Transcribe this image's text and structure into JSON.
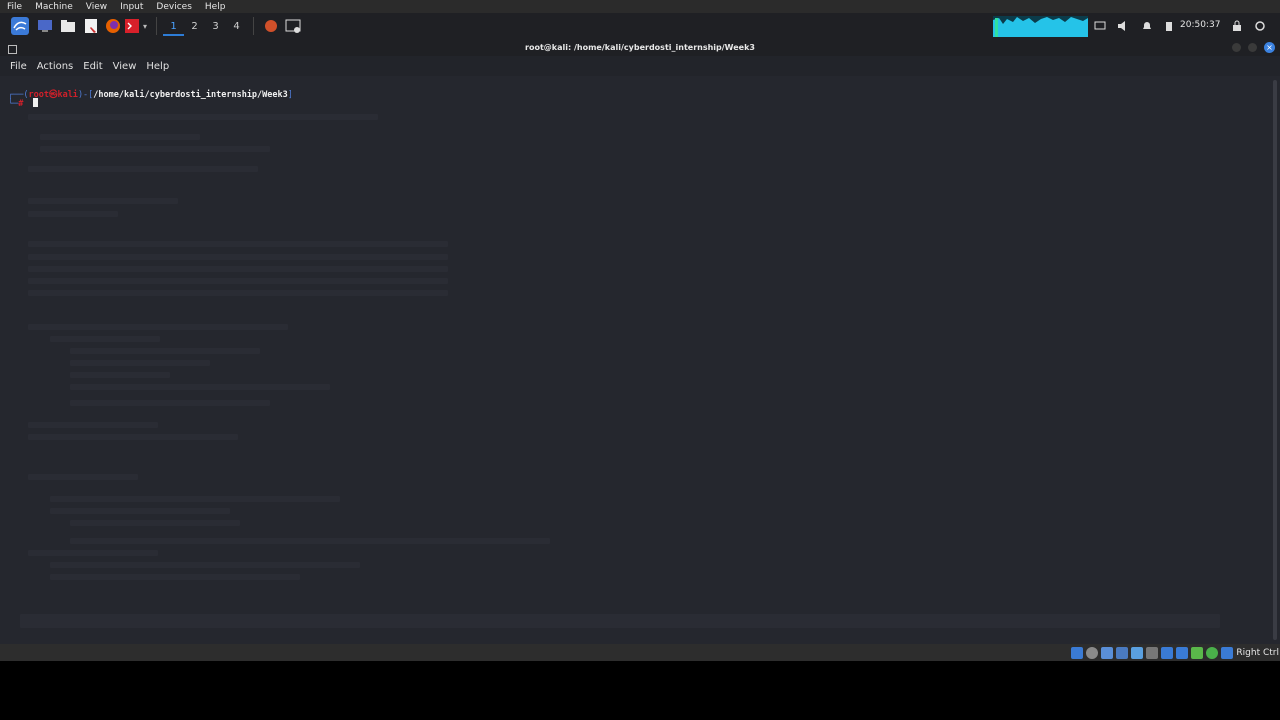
{
  "vbox_menu": [
    "File",
    "Machine",
    "View",
    "Input",
    "Devices",
    "Help"
  ],
  "panel": {
    "workspaces": [
      "1",
      "2",
      "3",
      "4"
    ],
    "active_workspace": "1",
    "clock": "20:50:37",
    "icons": [
      "kali-menu-icon",
      "desktop-icon",
      "file-manager-icon",
      "text-editor-icon",
      "firefox-icon",
      "terminal-icon",
      "dropdown-icon"
    ],
    "colors": {
      "panel_bg": "#1f2024",
      "active_ws": "#4aa3ff"
    }
  },
  "window": {
    "title": "root@kali: /home/kali/cyberdosti_internship/Week3"
  },
  "term_menu": [
    "File",
    "Actions",
    "Edit",
    "View",
    "Help"
  ],
  "terminal": {
    "prompt_user": "root㉿kali",
    "prompt_path": "/home/kali/cyberdosti_internship/Week3",
    "colors": {
      "bg": "#25272e",
      "user": "#d0202a",
      "frame": "#4f7cd6"
    }
  },
  "statusbar": {
    "host_key": "Right Ctrl"
  }
}
